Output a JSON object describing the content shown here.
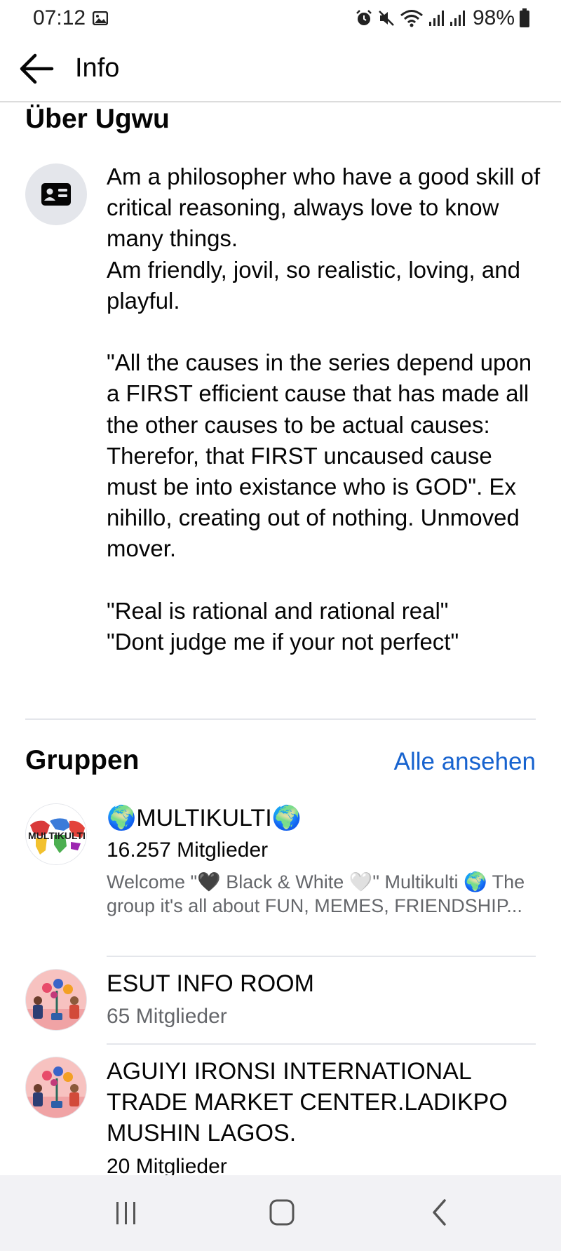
{
  "status_bar": {
    "time": "07:12",
    "battery": "98%",
    "icons": [
      "image-icon",
      "alarm-icon",
      "mute-icon",
      "wifi-icon",
      "signal-icon",
      "signal-icon",
      "battery-icon"
    ]
  },
  "app_bar": {
    "title": "Info",
    "back_icon": "back-arrow-icon"
  },
  "about": {
    "title": "Über Ugwu",
    "icon": "id-card-icon",
    "text": "Am a philosopher who have a good skill of critical reasoning, always love to know many things.\nAm friendly, jovil, so realistic, loving, and playful.\n\n\"All the causes in the series depend upon a FIRST efficient cause that has made all the other causes to be actual causes: Therefor, that FIRST uncaused cause must be into existance who is GOD\". Ex nihillo, creating out of nothing. Unmoved mover.\n\n\"Real is rational and rational real\"\n\"Dont judge me if your not perfect\""
  },
  "groups": {
    "title": "Gruppen",
    "see_all": "Alle ansehen",
    "items": [
      {
        "name": "🌍MULTIKULTI🌍",
        "members": "16.257 Mitglieder",
        "description": "Welcome  \"🖤 Black & White 🤍\" Multikulti 🌍  The group it's all about FUN, MEMES, FRIENDSHIP...",
        "avatar_text": "MULTIKULTI"
      },
      {
        "name": "ESUT INFO ROOM",
        "members": "65 Mitglieder"
      },
      {
        "name": "AGUIYI IRONSI INTERNATIONAL TRADE MARKET CENTER.LADIKPO MUSHIN LAGOS.",
        "members": "20 Mitglieder"
      }
    ]
  },
  "nav_bar": {
    "icons": [
      "recents-icon",
      "home-icon",
      "back-icon"
    ]
  },
  "colors": {
    "link": "#1763cf",
    "muted_text": "#65676b",
    "divider": "#e4e6eb",
    "icon_circle": "#e4e6eb"
  }
}
